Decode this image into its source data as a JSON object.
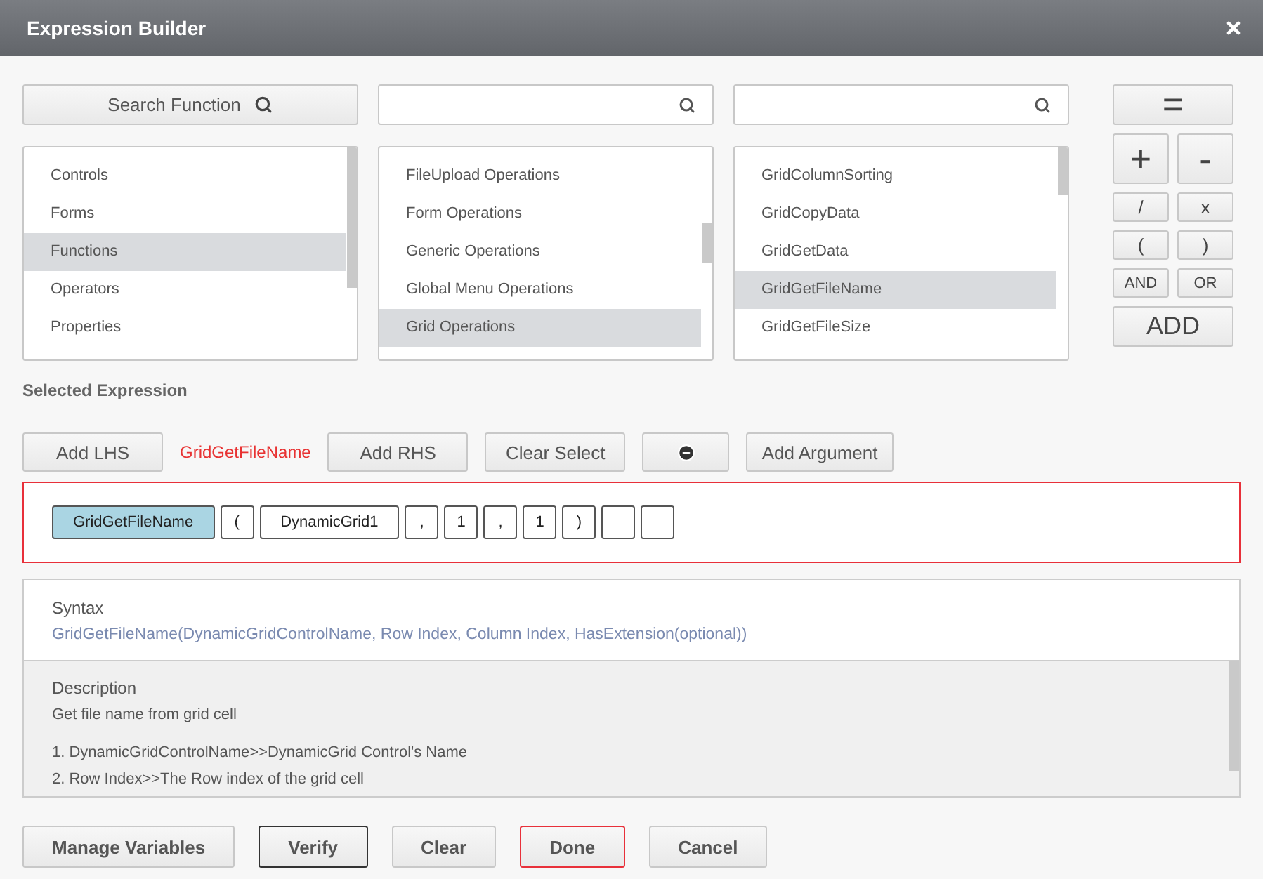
{
  "window": {
    "title": "Expression Builder"
  },
  "search_function_button": "Search Function",
  "categories": [
    {
      "label": "Controls",
      "selected": false
    },
    {
      "label": "Forms",
      "selected": false
    },
    {
      "label": "Functions",
      "selected": true
    },
    {
      "label": "Operators",
      "selected": false
    },
    {
      "label": "Properties",
      "selected": false
    }
  ],
  "operations": [
    {
      "label": "FileUpload Operations",
      "selected": false
    },
    {
      "label": "Form Operations",
      "selected": false
    },
    {
      "label": "Generic Operations",
      "selected": false
    },
    {
      "label": "Global Menu Operations",
      "selected": false
    },
    {
      "label": "Grid Operations",
      "selected": true
    }
  ],
  "functions": [
    {
      "label": "GridColumnSorting",
      "selected": false
    },
    {
      "label": "GridCopyData",
      "selected": false
    },
    {
      "label": "GridGetData",
      "selected": false
    },
    {
      "label": "GridGetFileName",
      "selected": true
    },
    {
      "label": "GridGetFileSize",
      "selected": false
    }
  ],
  "operator_buttons": [
    {
      "label": "=",
      "kind": "wide"
    },
    {
      "label": "+",
      "kind": "large"
    },
    {
      "label": "-",
      "kind": "large"
    },
    {
      "label": "/",
      "kind": "small"
    },
    {
      "label": "x",
      "kind": "small"
    },
    {
      "label": "(",
      "kind": "small"
    },
    {
      "label": ")",
      "kind": "small"
    },
    {
      "label": "AND",
      "kind": "small"
    },
    {
      "label": "OR",
      "kind": "small"
    },
    {
      "label": "ADD",
      "kind": "wide"
    }
  ],
  "selected_expression": {
    "heading": "Selected Expression",
    "current_function": "GridGetFileName",
    "buttons": [
      {
        "label": "Add LHS",
        "kind": "text"
      },
      {
        "kind": "current"
      },
      {
        "label": "Add RHS",
        "kind": "text"
      },
      {
        "label": "Clear Select",
        "kind": "text"
      },
      {
        "kind": "remove"
      },
      {
        "label": "Add Argument",
        "kind": "text"
      }
    ],
    "tokens": [
      {
        "text": "GridGetFileName",
        "selected": true
      },
      {
        "text": "(",
        "selected": false
      },
      {
        "text": "DynamicGrid1",
        "selected": false
      },
      {
        "text": ",",
        "selected": false
      },
      {
        "text": "1",
        "selected": false
      },
      {
        "text": ",",
        "selected": false
      },
      {
        "text": "1",
        "selected": false
      },
      {
        "text": ")",
        "selected": false
      },
      {
        "selected": false
      },
      {
        "selected": false
      }
    ]
  },
  "syntax": {
    "heading": "Syntax",
    "text": "GridGetFileName(DynamicGridControlName, Row Index, Column Index, HasExtension(optional))"
  },
  "description": {
    "heading": "Description",
    "summary": "Get file name from grid cell",
    "lines": [
      "1. DynamicGridControlName>>DynamicGrid Control's Name",
      "2. Row Index>>The Row index of the grid cell"
    ]
  },
  "footer_buttons": [
    {
      "label": "Manage Variables",
      "kind": "plain"
    },
    {
      "label": "Verify",
      "kind": "dark"
    },
    {
      "label": "Clear",
      "kind": "plain"
    },
    {
      "label": "Done",
      "kind": "red"
    },
    {
      "label": "Cancel",
      "kind": "plain"
    }
  ]
}
